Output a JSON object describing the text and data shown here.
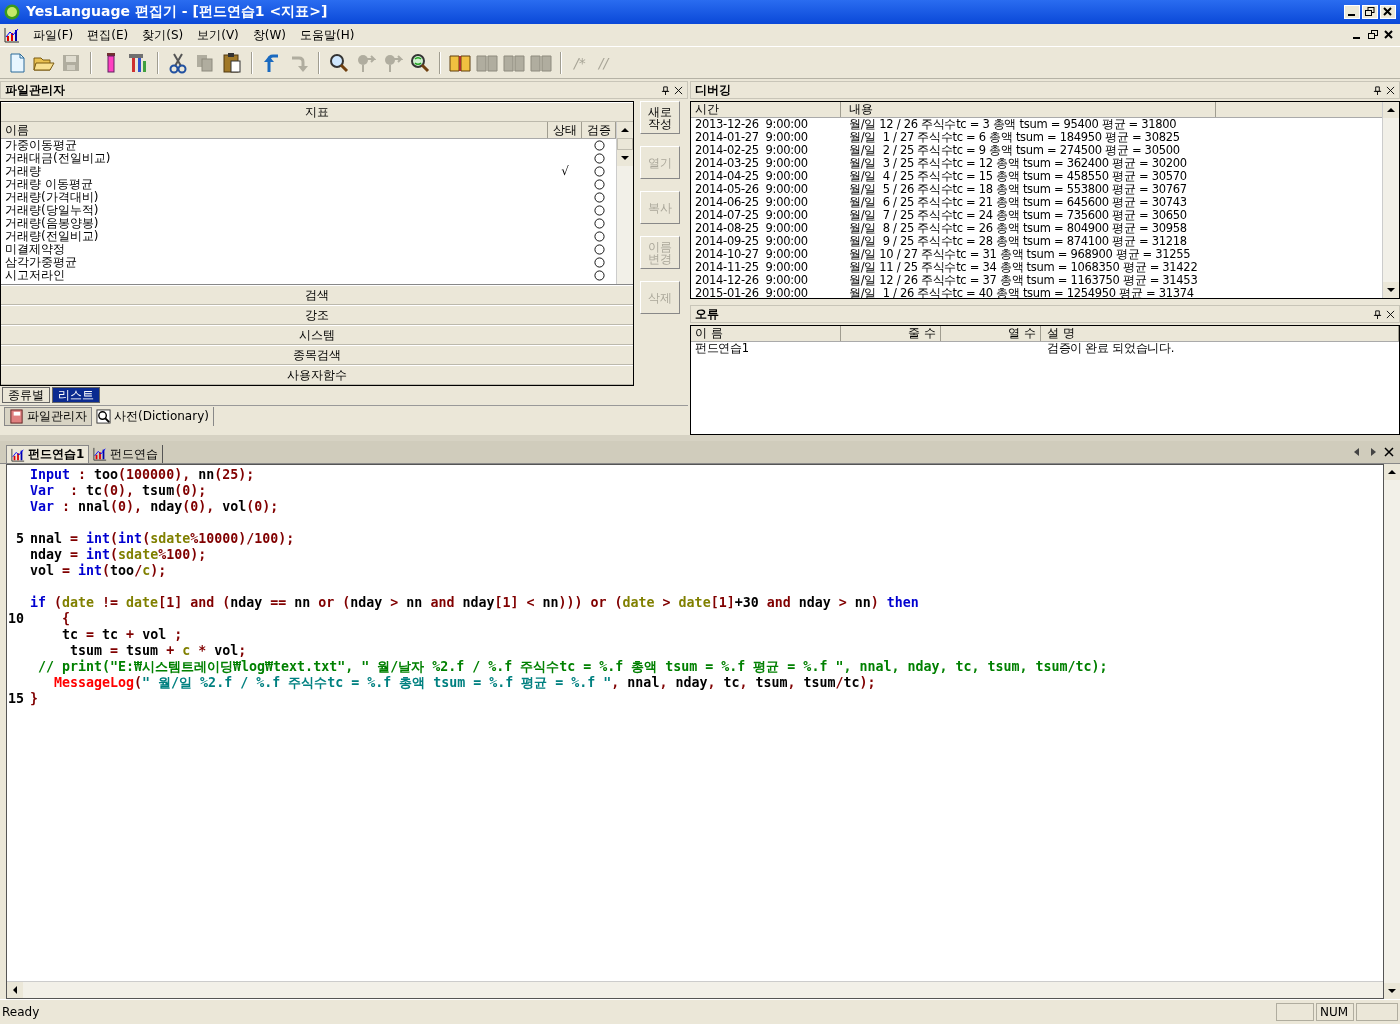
{
  "window": {
    "title": "YesLanguage 편집기 - [펀드연습1 <지표>]"
  },
  "menu": [
    "파일(F)",
    "편집(E)",
    "찾기(S)",
    "보기(V)",
    "창(W)",
    "도움말(H)"
  ],
  "toolbar": [
    {
      "kind": "new",
      "disabled": false
    },
    {
      "kind": "open",
      "disabled": false
    },
    {
      "kind": "save",
      "disabled": true
    },
    {
      "kind": "separator"
    },
    {
      "kind": "testtube",
      "disabled": false
    },
    {
      "kind": "tools",
      "disabled": false
    },
    {
      "kind": "separator"
    },
    {
      "kind": "cut",
      "disabled": false
    },
    {
      "kind": "copy",
      "disabled": true
    },
    {
      "kind": "paste",
      "disabled": false
    },
    {
      "kind": "separator"
    },
    {
      "kind": "undo",
      "disabled": false
    },
    {
      "kind": "redo",
      "disabled": true
    },
    {
      "kind": "separator"
    },
    {
      "kind": "find",
      "disabled": false
    },
    {
      "kind": "pin",
      "disabled": true
    },
    {
      "kind": "pin",
      "disabled": true
    },
    {
      "kind": "replace",
      "disabled": false
    },
    {
      "kind": "separator"
    },
    {
      "kind": "book",
      "disabled": false
    },
    {
      "kind": "book",
      "disabled": true
    },
    {
      "kind": "book",
      "disabled": true
    },
    {
      "kind": "book",
      "disabled": true
    },
    {
      "kind": "separator"
    },
    {
      "kind": "text",
      "label": "/*",
      "disabled": true
    },
    {
      "kind": "text",
      "label": "//",
      "disabled": true
    }
  ],
  "file_manager": {
    "title": "파일관리자",
    "category": "지표",
    "columns": [
      "이름",
      "상태",
      "검증"
    ],
    "items": [
      {
        "name": "가중이동평균",
        "checked": false
      },
      {
        "name": "거래대금(전일비교)",
        "checked": false
      },
      {
        "name": "거래량",
        "checked": true
      },
      {
        "name": "거래량 이동평균",
        "checked": false
      },
      {
        "name": "거래량(가격대비)",
        "checked": false
      },
      {
        "name": "거래량(당일누적)",
        "checked": false
      },
      {
        "name": "거래량(음봉양봉)",
        "checked": false
      },
      {
        "name": "거래량(전일비교)",
        "checked": false
      },
      {
        "name": "미결제약정",
        "checked": false
      },
      {
        "name": "삼각가중평균",
        "checked": false
      },
      {
        "name": "시고저라인",
        "checked": false
      }
    ],
    "status_mark": "√",
    "sections": [
      "검색",
      "강조",
      "시스템",
      "종목검색",
      "사용자함수"
    ],
    "buttons": [
      {
        "label": "새로작성",
        "disabled": false
      },
      {
        "label": "열기",
        "disabled": true
      },
      {
        "label": "복사",
        "disabled": true
      },
      {
        "label": "이름변경",
        "disabled": true
      },
      {
        "label": "삭제",
        "disabled": true
      }
    ],
    "view_tabs": [
      {
        "label": "종류별",
        "selected": false
      },
      {
        "label": "리스트",
        "selected": true
      }
    ],
    "panel_tabs": [
      {
        "label": "파일관리자",
        "selected": true
      },
      {
        "label": "사전(Dictionary)",
        "selected": false
      }
    ]
  },
  "debug": {
    "title": "디버깅",
    "columns": [
      "시간",
      "내용"
    ],
    "rows": [
      {
        "time": "2013-12-26  9:00:00",
        "content": "월/일 12 / 26 주식수tc = 3 총액 tsum = 95400 평균 = 31800"
      },
      {
        "time": "2014-01-27  9:00:00",
        "content": "월/일  1 / 27 주식수tc = 6 총액 tsum = 184950 평균 = 30825"
      },
      {
        "time": "2014-02-25  9:00:00",
        "content": "월/일  2 / 25 주식수tc = 9 총액 tsum = 274500 평균 = 30500"
      },
      {
        "time": "2014-03-25  9:00:00",
        "content": "월/일  3 / 25 주식수tc = 12 총액 tsum = 362400 평균 = 30200"
      },
      {
        "time": "2014-04-25  9:00:00",
        "content": "월/일  4 / 25 주식수tc = 15 총액 tsum = 458550 평균 = 30570"
      },
      {
        "time": "2014-05-26  9:00:00",
        "content": "월/일  5 / 26 주식수tc = 18 총액 tsum = 553800 평균 = 30767"
      },
      {
        "time": "2014-06-25  9:00:00",
        "content": "월/일  6 / 25 주식수tc = 21 총액 tsum = 645600 평균 = 30743"
      },
      {
        "time": "2014-07-25  9:00:00",
        "content": "월/일  7 / 25 주식수tc = 24 총액 tsum = 735600 평균 = 30650"
      },
      {
        "time": "2014-08-25  9:00:00",
        "content": "월/일  8 / 25 주식수tc = 26 총액 tsum = 804900 평균 = 30958"
      },
      {
        "time": "2014-09-25  9:00:00",
        "content": "월/일  9 / 25 주식수tc = 28 총액 tsum = 874100 평균 = 31218"
      },
      {
        "time": "2014-10-27  9:00:00",
        "content": "월/일 10 / 27 주식수tc = 31 총액 tsum = 968900 평균 = 31255"
      },
      {
        "time": "2014-11-25  9:00:00",
        "content": "월/일 11 / 25 주식수tc = 34 총액 tsum = 1068350 평균 = 31422"
      },
      {
        "time": "2014-12-26  9:00:00",
        "content": "월/일 12 / 26 주식수tc = 37 총액 tsum = 1163750 평균 = 31453"
      },
      {
        "time": "2015-01-26  9:00:00",
        "content": "월/일  1 / 26 주식수tc = 40 총액 tsum = 1254950 평균 = 31374"
      }
    ]
  },
  "errors": {
    "title": "오류",
    "columns": [
      "이 름",
      "줄 수",
      "열 수",
      "설 명"
    ],
    "rows": [
      {
        "name": "펀드연습1",
        "description": "검증이 완료 되었습니다."
      }
    ]
  },
  "editor": {
    "tabs": [
      {
        "label": "펀드연습1",
        "selected": true
      },
      {
        "label": "펀드연습",
        "selected": false
      }
    ],
    "lines": [
      {
        "segments": [
          {
            "kind": "keyword",
            "text": "Input"
          },
          {
            "kind": "punct",
            "text": " : "
          },
          {
            "kind": "ident",
            "text": "too"
          },
          {
            "kind": "punct",
            "text": "(100000), "
          },
          {
            "kind": "ident",
            "text": "nn"
          },
          {
            "kind": "punct",
            "text": "(25);"
          }
        ]
      },
      {
        "segments": [
          {
            "kind": "keyword",
            "text": "Var"
          },
          {
            "kind": "punct",
            "text": "  : "
          },
          {
            "kind": "ident",
            "text": "tc"
          },
          {
            "kind": "punct",
            "text": "(0), "
          },
          {
            "kind": "ident",
            "text": "tsum"
          },
          {
            "kind": "punct",
            "text": "(0);"
          }
        ]
      },
      {
        "segments": [
          {
            "kind": "keyword",
            "text": "Var"
          },
          {
            "kind": "punct",
            "text": " : "
          },
          {
            "kind": "ident",
            "text": "nnal"
          },
          {
            "kind": "punct",
            "text": "(0), "
          },
          {
            "kind": "ident",
            "text": "nday"
          },
          {
            "kind": "punct",
            "text": "(0), "
          },
          {
            "kind": "ident",
            "text": "vol"
          },
          {
            "kind": "punct",
            "text": "(0);"
          }
        ]
      },
      {
        "number": "5",
        "blank_before": true,
        "segments": [
          {
            "kind": "ident",
            "text": "nnal"
          },
          {
            "kind": "punct",
            "text": " = "
          },
          {
            "kind": "keyword",
            "text": "int"
          },
          {
            "kind": "punct",
            "text": "("
          },
          {
            "kind": "keyword",
            "text": "int"
          },
          {
            "kind": "punct",
            "text": "("
          },
          {
            "kind": "builtin",
            "text": "sdate"
          },
          {
            "kind": "punct",
            "text": "%10000)/100);"
          }
        ]
      },
      {
        "segments": [
          {
            "kind": "ident",
            "text": "nday"
          },
          {
            "kind": "punct",
            "text": " = "
          },
          {
            "kind": "keyword",
            "text": "int"
          },
          {
            "kind": "punct",
            "text": "("
          },
          {
            "kind": "builtin",
            "text": "sdate"
          },
          {
            "kind": "punct",
            "text": "%100);"
          }
        ]
      },
      {
        "segments": [
          {
            "kind": "ident",
            "text": "vol"
          },
          {
            "kind": "punct",
            "text": " = "
          },
          {
            "kind": "keyword",
            "text": "int"
          },
          {
            "kind": "punct",
            "text": "("
          },
          {
            "kind": "ident",
            "text": "too"
          },
          {
            "kind": "punct",
            "text": "/"
          },
          {
            "kind": "builtin",
            "text": "c"
          },
          {
            "kind": "punct",
            "text": ");"
          }
        ]
      },
      {
        "blank_before": true,
        "segments": [
          {
            "kind": "keyword",
            "text": "if"
          },
          {
            "kind": "punct",
            "text": " ("
          },
          {
            "kind": "builtin",
            "text": "date"
          },
          {
            "kind": "punct",
            "text": " != "
          },
          {
            "kind": "builtin",
            "text": "date"
          },
          {
            "kind": "punct",
            "text": "[1] and ("
          },
          {
            "kind": "ident",
            "text": "nday"
          },
          {
            "kind": "punct",
            "text": " == "
          },
          {
            "kind": "ident",
            "text": "nn"
          },
          {
            "kind": "punct",
            "text": " or ("
          },
          {
            "kind": "ident",
            "text": "nday"
          },
          {
            "kind": "punct",
            "text": " > "
          },
          {
            "kind": "ident",
            "text": "nn"
          },
          {
            "kind": "punct",
            "text": " and "
          },
          {
            "kind": "ident",
            "text": "nday"
          },
          {
            "kind": "punct",
            "text": "[1] < "
          },
          {
            "kind": "ident",
            "text": "nn"
          },
          {
            "kind": "punct",
            "text": "))) or ("
          },
          {
            "kind": "builtin",
            "text": "date"
          },
          {
            "kind": "punct",
            "text": " > "
          },
          {
            "kind": "builtin",
            "text": "date"
          },
          {
            "kind": "punct",
            "text": "[1]"
          },
          {
            "kind": "ident",
            "text": "+30 "
          },
          {
            "kind": "punct",
            "text": "and "
          },
          {
            "kind": "ident",
            "text": "nday"
          },
          {
            "kind": "punct",
            "text": " > "
          },
          {
            "kind": "ident",
            "text": "nn"
          },
          {
            "kind": "punct",
            "text": ") "
          },
          {
            "kind": "keyword",
            "text": "then"
          }
        ]
      },
      {
        "number": "10",
        "segments": [
          {
            "kind": "punct",
            "text": "    {"
          }
        ]
      },
      {
        "segments": [
          {
            "kind": "ident",
            "text": "    tc"
          },
          {
            "kind": "punct",
            "text": " = "
          },
          {
            "kind": "ident",
            "text": "tc"
          },
          {
            "kind": "punct",
            "text": " + "
          },
          {
            "kind": "ident",
            "text": "vol"
          },
          {
            "kind": "punct",
            "text": " ;"
          }
        ]
      },
      {
        "segments": [
          {
            "kind": "ident",
            "text": "     tsum"
          },
          {
            "kind": "punct",
            "text": " = "
          },
          {
            "kind": "ident",
            "text": "tsum"
          },
          {
            "kind": "punct",
            "text": " + "
          },
          {
            "kind": "builtin",
            "text": "c"
          },
          {
            "kind": "punct",
            "text": " * "
          },
          {
            "kind": "ident",
            "text": "vol"
          },
          {
            "kind": "punct",
            "text": ";"
          }
        ]
      },
      {
        "segments": [
          {
            "kind": "comment",
            "text": " // print(\"E:₩시스템트레이딩₩log₩text.txt\", \" 월/날자 %2.f / %.f 주식수tc = %.f 총액 tsum = %.f 평균 = %.f \", nnal, nday, tc, tsum, tsum/tc);"
          }
        ]
      },
      {
        "segments": [
          {
            "kind": "function",
            "text": "   MessageLog"
          },
          {
            "kind": "punct",
            "text": "("
          },
          {
            "kind": "string",
            "text": "\" 월/일 %2.f / %.f 주식수tc = %.f 총액 tsum = %.f 평균 = %.f \""
          },
          {
            "kind": "punct",
            "text": ", "
          },
          {
            "kind": "ident",
            "text": "nnal"
          },
          {
            "kind": "punct",
            "text": ", "
          },
          {
            "kind": "ident",
            "text": "nday"
          },
          {
            "kind": "punct",
            "text": ", "
          },
          {
            "kind": "ident",
            "text": "tc"
          },
          {
            "kind": "punct",
            "text": ", "
          },
          {
            "kind": "ident",
            "text": "tsum"
          },
          {
            "kind": "punct",
            "text": ", "
          },
          {
            "kind": "ident",
            "text": "tsum"
          },
          {
            "kind": "punct",
            "text": "/"
          },
          {
            "kind": "ident",
            "text": "tc"
          },
          {
            "kind": "punct",
            "text": ");"
          }
        ]
      },
      {
        "number": "15",
        "segments": [
          {
            "kind": "punct",
            "text": "}"
          }
        ]
      }
    ]
  },
  "status_bar": {
    "message": "Ready",
    "indicators": [
      "NUM"
    ]
  }
}
